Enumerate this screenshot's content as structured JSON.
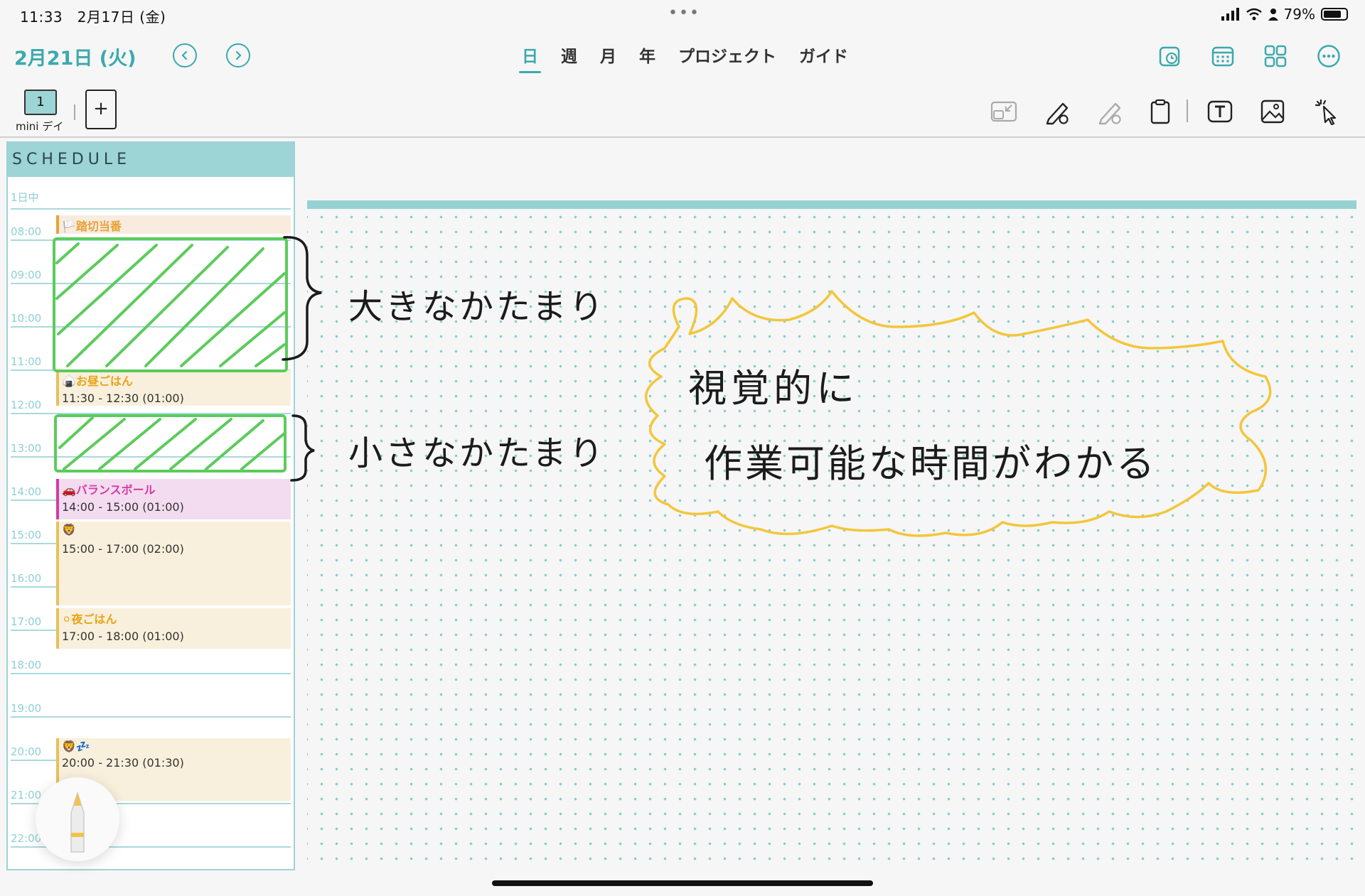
{
  "status_bar": {
    "time": "11:33",
    "date": "2月17日 (金)",
    "dots": "•••",
    "battery": "79%",
    "battery_level": 0.79
  },
  "header": {
    "date_title": "2月21日 (火)",
    "tabs": [
      {
        "label": "日",
        "active": true
      },
      {
        "label": "週",
        "active": false
      },
      {
        "label": "月",
        "active": false
      },
      {
        "label": "年",
        "active": false
      },
      {
        "label": "プロジェクト",
        "active": false
      },
      {
        "label": "ガイド",
        "active": false
      }
    ],
    "right_icons": [
      "clock-calendar-icon",
      "calendar-icon",
      "grid-icon",
      "more-icon"
    ]
  },
  "toolbar": {
    "page_number": "1",
    "page_label": "mini デイ",
    "add_label": "+",
    "tools": [
      "shrink-icon",
      "pen-icon",
      "pen-disabled-icon",
      "clipboard-icon",
      "text-box-icon",
      "image-icon",
      "lasso-icon"
    ]
  },
  "schedule": {
    "header": "SCHEDULE",
    "allday_label": "1日中",
    "hours": [
      "08:00",
      "09:00",
      "10:00",
      "11:00",
      "12:00",
      "13:00",
      "14:00",
      "15:00",
      "16:00",
      "17:00",
      "18:00",
      "19:00",
      "20:00",
      "21:00",
      "22:00"
    ],
    "events": [
      {
        "icon": "🏳️",
        "title": "踏切当番",
        "time": ""
      },
      {
        "icon": "🍙",
        "title": "お昼ごはん",
        "time": "11:30 - 12:30 (01:00)"
      },
      {
        "icon": "🚗",
        "title": "バランスボール",
        "time": "14:00 - 15:00 (01:00)"
      },
      {
        "icon": "🦁",
        "title": "",
        "time": "15:00 - 17:00 (02:00)"
      },
      {
        "icon": "⚪",
        "title": "夜ごはん",
        "time": "17:00 - 18:00 (01:00)"
      },
      {
        "icon": "🦁💤",
        "title": "",
        "time": "20:00 - 21:30 (01:30)"
      }
    ],
    "event_colors": {
      "yellow": "#e8c058",
      "pink": "#d63aa6",
      "orange": "#e8a23a"
    }
  },
  "notes": {
    "large_block_label": "大きなかたまり",
    "small_block_label": "小さなかたまり",
    "bubble_line1": "視覚的に",
    "bubble_line2": "作業可能な時間がわかる",
    "colors": {
      "highlighter": "#5ccb5c",
      "bubble": "#f3c63b",
      "teal": "#3ca9ad"
    }
  }
}
